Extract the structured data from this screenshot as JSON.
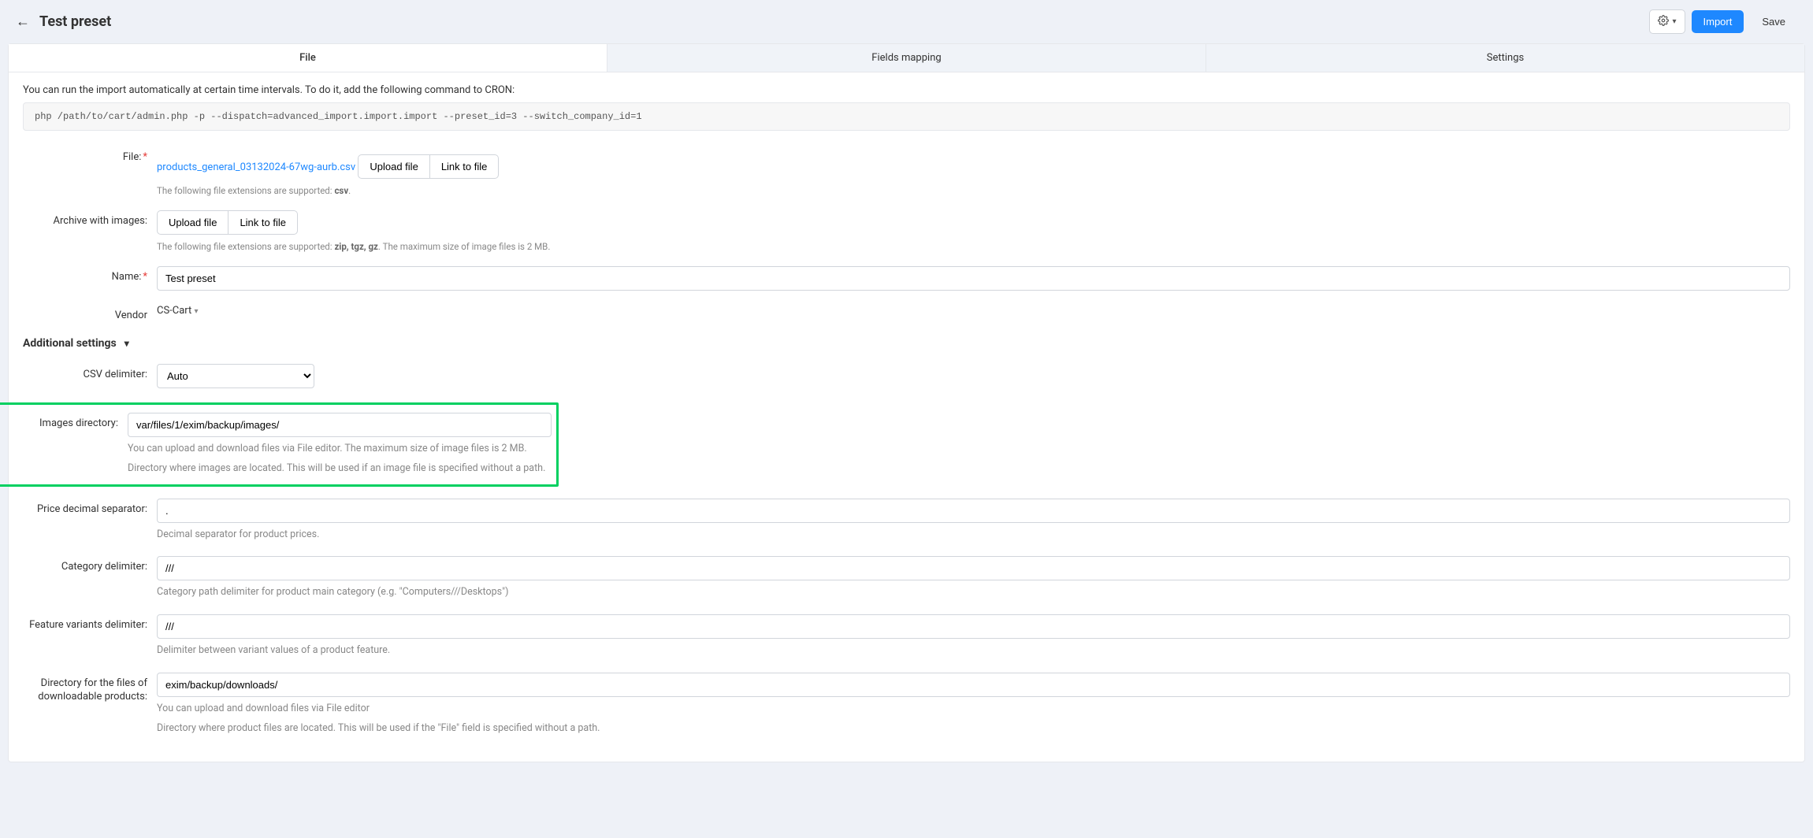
{
  "header": {
    "title": "Test preset",
    "gear_icon": "gear",
    "import_label": "Import",
    "save_label": "Save"
  },
  "tabs": {
    "file": "File",
    "fields_mapping": "Fields mapping",
    "settings": "Settings"
  },
  "cron": {
    "note": "You can run the import automatically at certain time intervals. To do it, add the following command to CRON:",
    "command": "php /path/to/cart/admin.php -p --dispatch=advanced_import.import.import --preset_id=3 --switch_company_id=1"
  },
  "form": {
    "file_label": "File:",
    "file_name": "products_general_03132024-67wg-aurb.csv",
    "upload_file": "Upload file",
    "link_to_file": "Link to file",
    "file_hint_prefix": "The following file extensions are supported: ",
    "file_hint_ext": "csv",
    "file_hint_suffix": ".",
    "archive_label": "Archive with images:",
    "archive_hint_prefix": "The following file extensions are supported: ",
    "archive_hint_ext": "zip, tgz, gz",
    "archive_hint_suffix": ". The maximum size of image files is 2 MB.",
    "name_label": "Name:",
    "name_value": "Test preset",
    "vendor_label": "Vendor",
    "vendor_value": "CS-Cart"
  },
  "additional": {
    "section_title": "Additional settings",
    "csv_delim_label": "CSV delimiter:",
    "csv_delim_value": "Auto",
    "images_dir_label": "Images directory:",
    "images_dir_value": "var/files/1/exim/backup/images/",
    "images_dir_desc1": "You can upload and download files via File editor. The maximum size of image files is 2 MB.",
    "images_dir_desc2": "Directory where images are located. This will be used if an image file is specified without a path.",
    "price_sep_label": "Price decimal separator:",
    "price_sep_value": ".",
    "price_sep_desc": "Decimal separator for product prices.",
    "cat_delim_label": "Category delimiter:",
    "cat_delim_value": "///",
    "cat_delim_desc": "Category path delimiter for product main category (e.g. \"Computers///Desktops\")",
    "feat_delim_label": "Feature variants delimiter:",
    "feat_delim_value": "///",
    "feat_delim_desc": "Delimiter between variant values of a product feature.",
    "dl_dir_label": "Directory for the files of downloadable products:",
    "dl_dir_value": "exim/backup/downloads/",
    "dl_dir_desc1": "You can upload and download files via File editor",
    "dl_dir_desc2": "Directory where product files are located. This will be used if the \"File\" field is specified without a path."
  }
}
